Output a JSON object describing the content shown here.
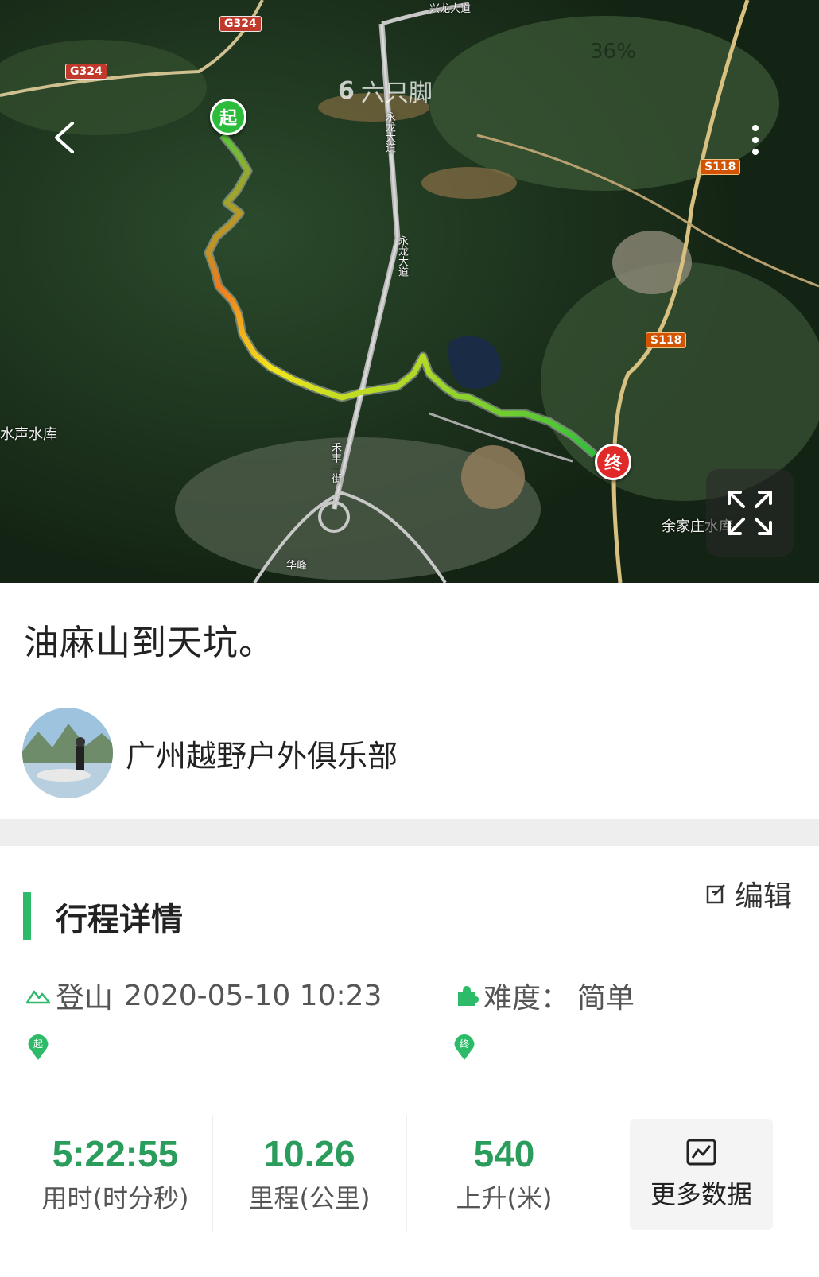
{
  "map": {
    "road_labels": {
      "g324_top": "G324",
      "g324_left": "G324",
      "s118_upper": "S118",
      "s118_lower": "S118"
    },
    "place_labels": {
      "reservoir_left": "水声水库",
      "reservoir_right": "余家庄水库",
      "road_vertical_1": "永龙大道",
      "road_vertical_2": "永龙大道",
      "road_top": "兴龙大道",
      "road_lower": "禾丰一街",
      "road_bottom": "华峰"
    },
    "watermark": "六只脚",
    "status_ghost": "36%",
    "start_marker": "起",
    "end_marker": "终",
    "icons": {
      "back": "chevron-left-icon",
      "more": "more-vertical-icon",
      "fullscreen": "fullscreen-icon"
    },
    "colors": {
      "track_start": "#4ccf3a",
      "track_mid": "#f2e51a",
      "track_hot": "#f07a1e",
      "track_end": "#2fbf3a",
      "start_marker": "#2dbb3c",
      "end_marker": "#e02a2a"
    }
  },
  "route": {
    "title": "油麻山到天坑。"
  },
  "author": {
    "name": "广州越野户外俱乐部"
  },
  "details": {
    "section_title": "行程详情",
    "edit_label": "编辑",
    "trip_type": "登山",
    "datetime": "2020-05-10 10:23",
    "difficulty_label": "难度：",
    "difficulty_value": "简单",
    "start_pin": "起",
    "end_pin": "终",
    "accent_color": "#2dbb6a"
  },
  "stats": [
    {
      "value": "5:22:55",
      "label": "用时(时分秒)"
    },
    {
      "value": "10.26",
      "label": "里程(公里)"
    },
    {
      "value": "540",
      "label": "上升(米)"
    }
  ],
  "more_data": {
    "label": "更多数据",
    "icon": "chart-icon"
  }
}
